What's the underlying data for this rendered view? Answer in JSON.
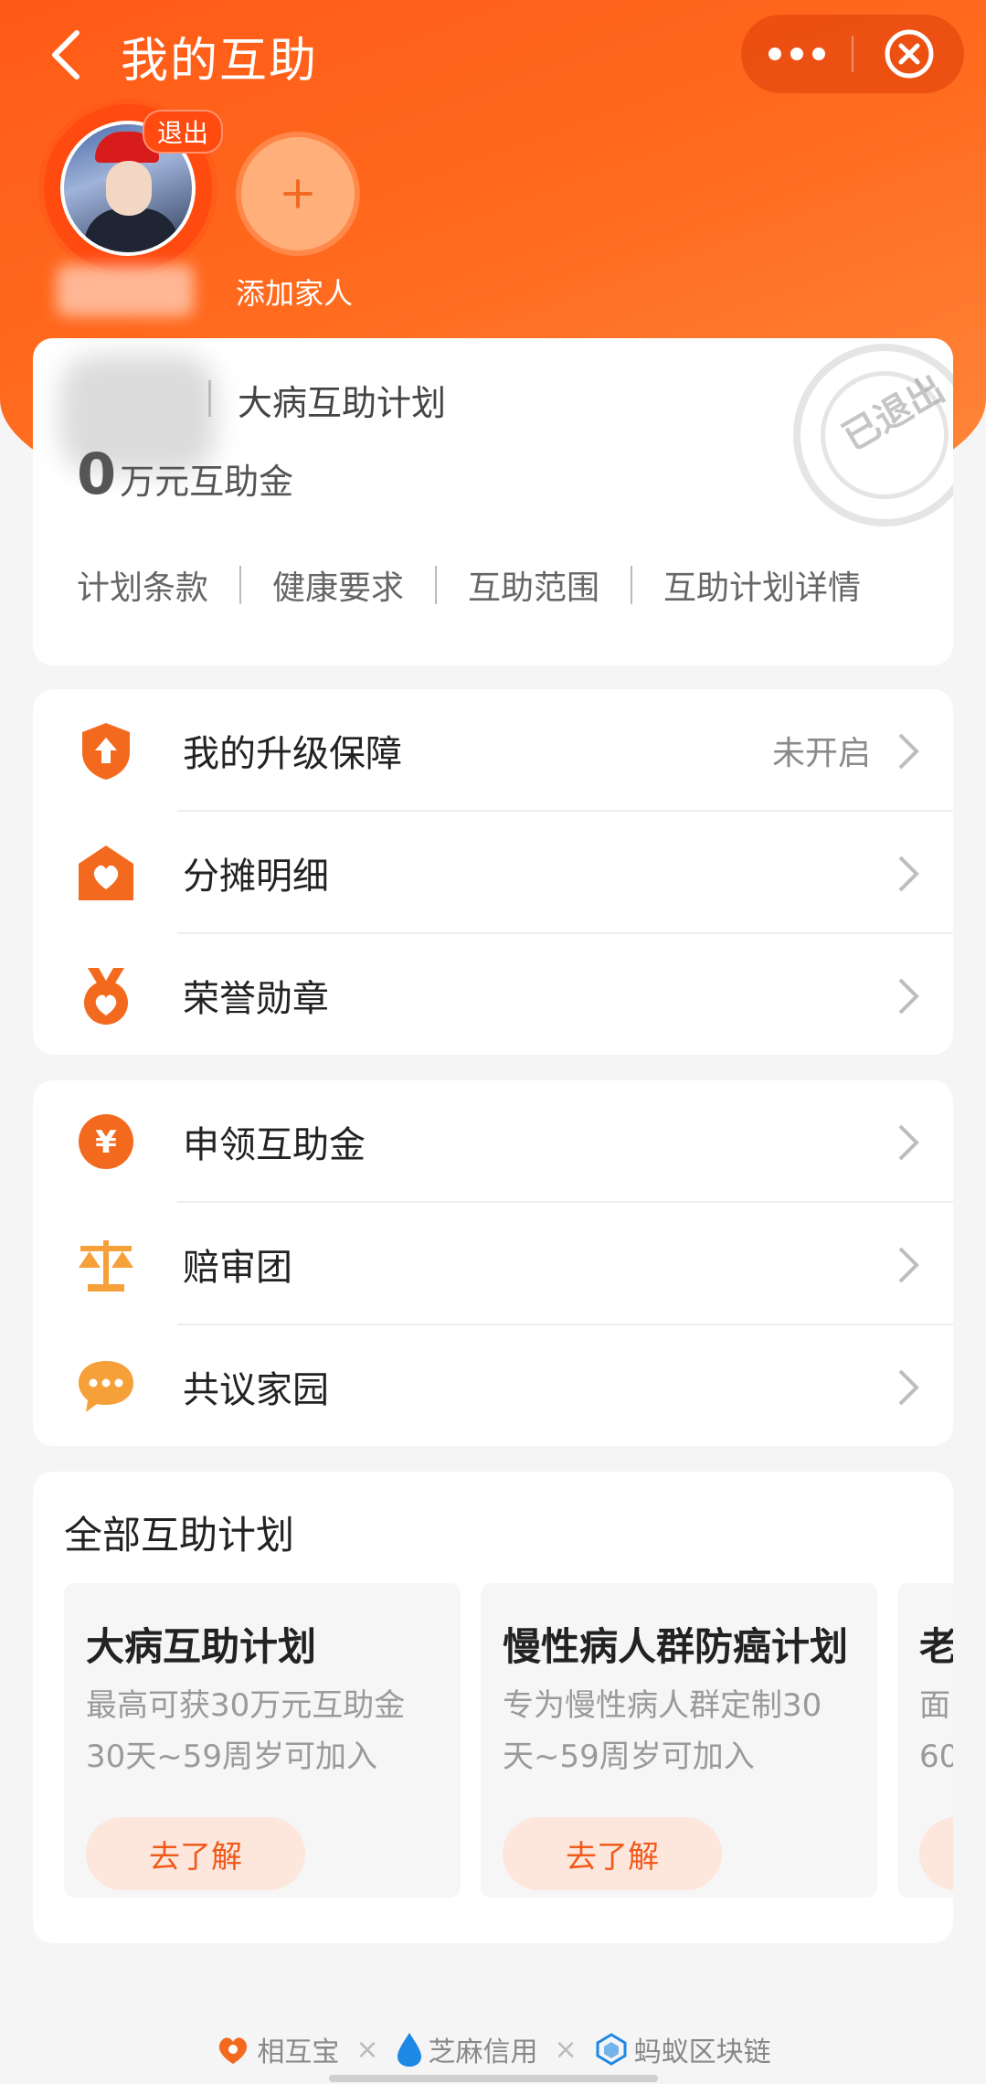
{
  "header": {
    "title": "我的互助",
    "avatar_badge": "退出",
    "add_family_label": "添加家人"
  },
  "plan_card": {
    "plan_name": "大病互助计划",
    "amount_value": "0",
    "amount_unit": "万元互助金",
    "stamp_text": "已退出",
    "links": [
      "计划条款",
      "健康要求",
      "互助范围",
      "互助计划详情"
    ]
  },
  "menu_group_1": {
    "items": [
      {
        "label": "我的升级保障",
        "status": "未开启",
        "icon": "shield-up-icon"
      },
      {
        "label": "分摊明细",
        "status": "",
        "icon": "house-heart-icon"
      },
      {
        "label": "荣誉勋章",
        "status": "",
        "icon": "medal-heart-icon"
      }
    ]
  },
  "menu_group_2": {
    "items": [
      {
        "label": "申领互助金",
        "icon": "yuan-icon"
      },
      {
        "label": "赔审团",
        "icon": "scales-icon"
      },
      {
        "label": "共议家园",
        "icon": "chat-bubble-icon"
      }
    ]
  },
  "all_plans": {
    "title": "全部互助计划",
    "tiles": [
      {
        "title": "大病互助计划",
        "desc1": "最高可获30万元互助金",
        "desc2": "30天~59周岁可加入",
        "button": "去了解"
      },
      {
        "title": "慢性病人群防癌计划",
        "desc1": "专为慢性病人群定制30",
        "desc2": "天~59周岁可加入",
        "button": "去了解"
      },
      {
        "title": "老",
        "desc1": "面",
        "desc2": "60",
        "button": ""
      }
    ]
  },
  "footer": {
    "brand1": "相互宝",
    "brand2": "芝麻信用",
    "brand3": "蚂蚁区块链",
    "sep": "×"
  },
  "colors": {
    "accent": "#ff5a17",
    "button_bg": "#fde6dc",
    "button_text": "#f05a1a"
  }
}
